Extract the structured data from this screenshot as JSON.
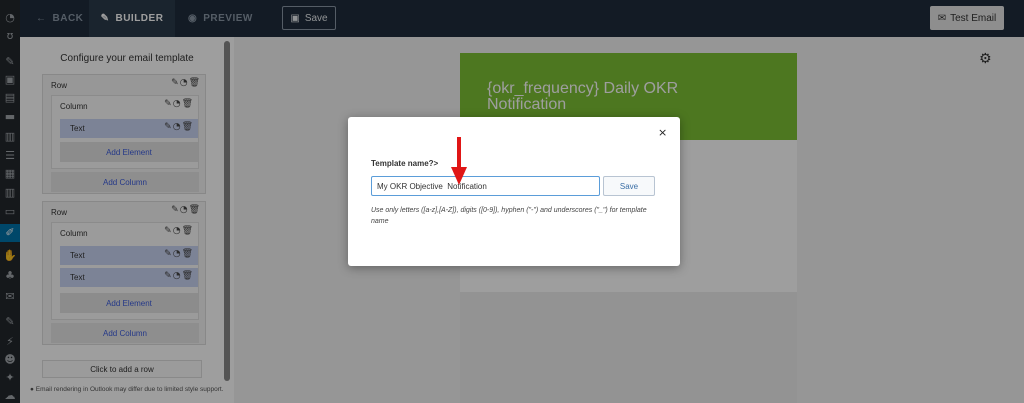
{
  "toolbar": {
    "back_label": "BACK",
    "builder_label": "BUILDER",
    "preview_label": "PREVIEW",
    "save_label": "Save",
    "test_email_label": "Test Email"
  },
  "panel": {
    "title": "Configure your email template",
    "rows": [
      {
        "label": "Row",
        "column_label": "Column",
        "elements": [
          "Text"
        ],
        "add_element_label": "Add Element",
        "add_column_label": "Add Column"
      },
      {
        "label": "Row",
        "column_label": "Column",
        "elements": [
          "Text",
          "Text"
        ],
        "add_element_label": "Add Element",
        "add_column_label": "Add Column"
      }
    ],
    "add_row_label": "Click to add a row",
    "footnote": "Email rendering in Outlook may differ due to limited style support."
  },
  "preview": {
    "header_text": "{okr_frequency} Daily OKR Notification",
    "header_color": "#7dc135"
  },
  "modal": {
    "label": "Template name?>",
    "input_value": "My OKR Objective  Notification",
    "save_label": "Save",
    "help_text": "Use only letters ([a-z],[A-Z]), digits ([0-9]), hyphen (\"-\") and underscores (\"_\") for template name",
    "close_symbol": "×"
  },
  "colors": {
    "accent": "#0073aa",
    "annotation_arrow": "#e01616"
  }
}
